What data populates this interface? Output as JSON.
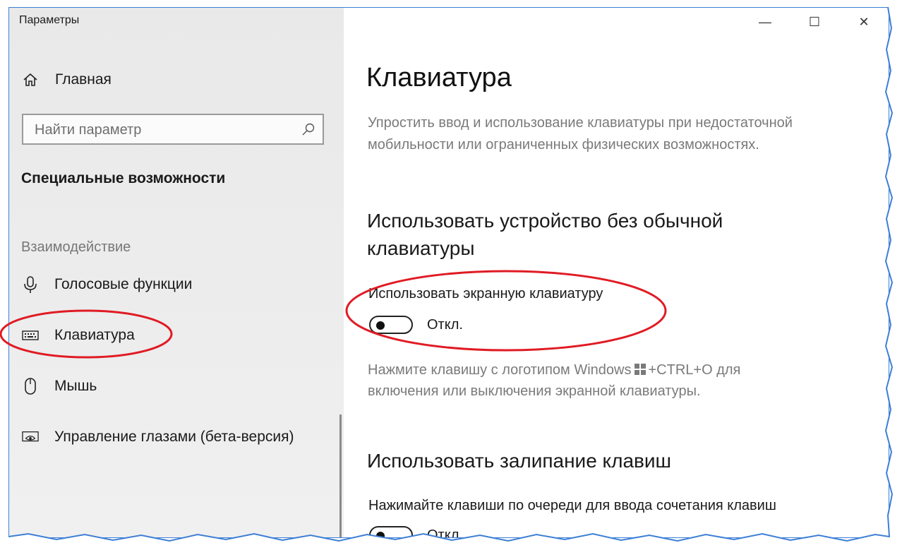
{
  "window": {
    "title": "Параметры",
    "controls": {
      "minimize": "—",
      "maximize": "☐",
      "close": "✕"
    }
  },
  "sidebar": {
    "home_label": "Главная",
    "search": {
      "placeholder": "Найти параметр",
      "value": ""
    },
    "section_heading": "Специальные возможности",
    "group_label": "Взаимодействие",
    "items": [
      {
        "label": "Голосовые функции",
        "icon": "microphone-icon"
      },
      {
        "label": "Клавиатура",
        "icon": "keyboard-icon",
        "selected": true
      },
      {
        "label": "Мышь",
        "icon": "mouse-icon"
      },
      {
        "label": "Управление глазами (бета-версия)",
        "icon": "eye-control-icon"
      }
    ]
  },
  "main": {
    "page_title": "Клавиатура",
    "description": "Упростить ввод и использование клавиатуры при недостаточной мобильности или ограниченных физических возможностях.",
    "section1": {
      "heading": "Использовать устройство без обычной клавиатуры",
      "setting_label": "Использовать экранную клавиатуру",
      "toggle_state": "Откл.",
      "hint_before": "Нажмите клавишу с логотипом Windows",
      "hint_after": "+CTRL+O для включения или выключения экранной клавиатуры."
    },
    "section2": {
      "heading": "Использовать залипание клавиш",
      "setting_label": "Нажимайте клавиши по очереди для ввода сочетания клавиш",
      "toggle_state": "Откл."
    }
  },
  "colors": {
    "highlight_oval": "#e01b24",
    "window_border": "#3d7fd6",
    "sidebar_bg": "#ececec",
    "secondary_text": "#7a7a7a"
  }
}
